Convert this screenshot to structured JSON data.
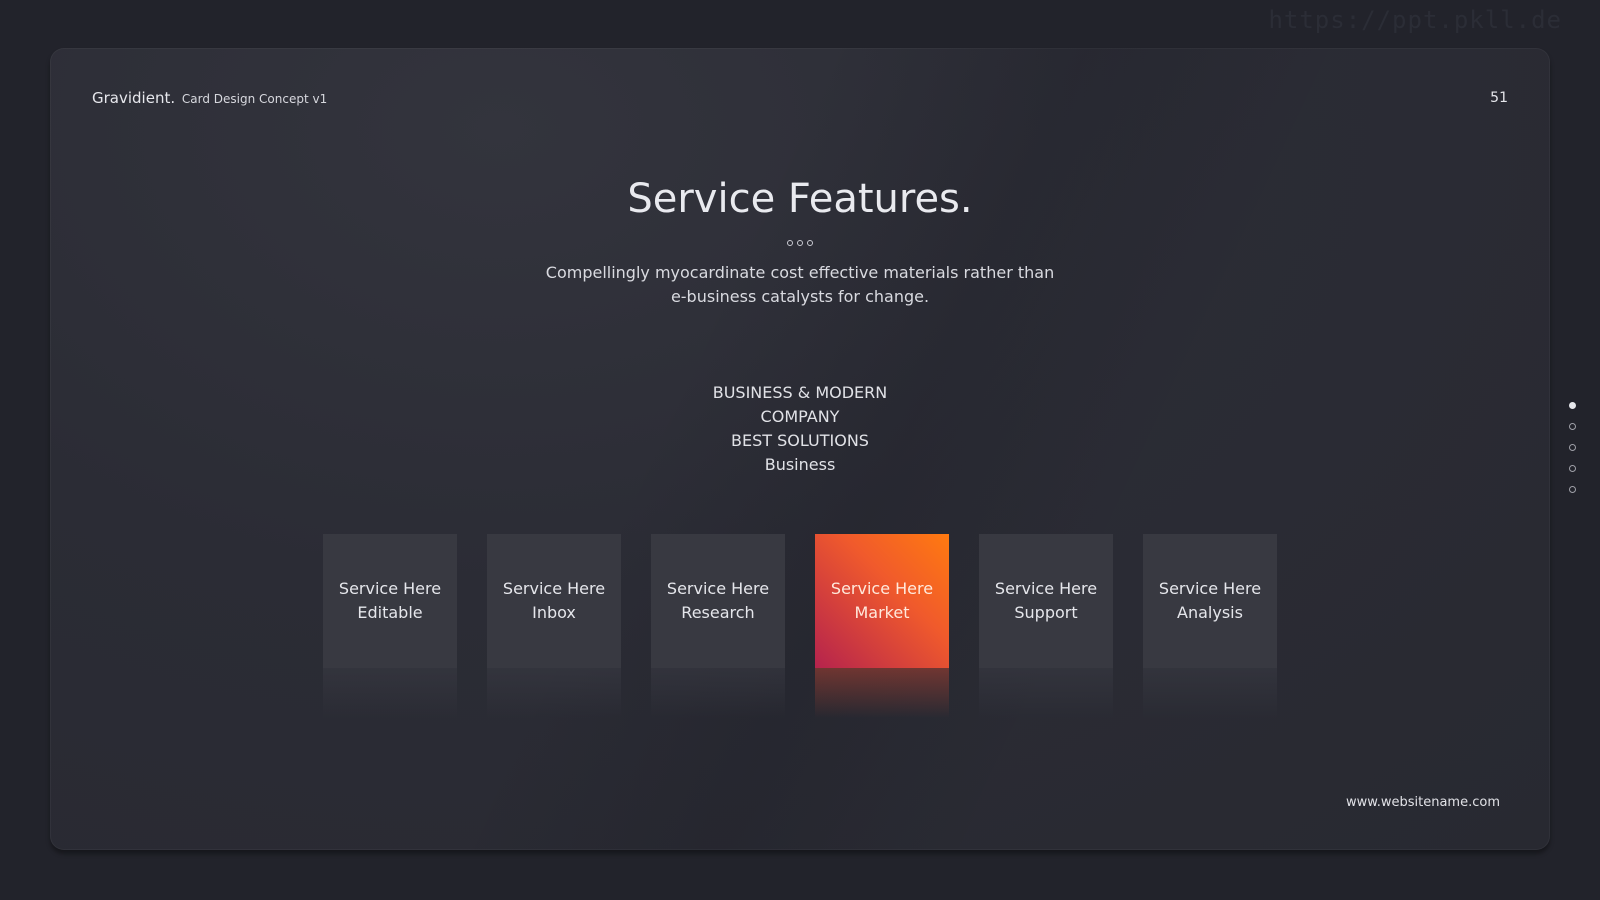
{
  "watermark": "https://ppt.pkll.de",
  "header": {
    "brand": "Gravidient.",
    "brand_sub": "Card Design Concept v1",
    "page_number": "51"
  },
  "main": {
    "title": "Service Features.",
    "subtitle_line1": "Compellingly myocardinate cost effective materials rather than",
    "subtitle_line2": "e-business catalysts for change.",
    "tagline": [
      "BUSINESS & MODERN",
      "COMPANY",
      "BEST SOLUTIONS",
      "Business"
    ]
  },
  "cards": [
    {
      "line1": "Service Here",
      "line2": "Editable",
      "active": false
    },
    {
      "line1": "Service Here",
      "line2": "Inbox",
      "active": false
    },
    {
      "line1": "Service Here",
      "line2": "Research",
      "active": false
    },
    {
      "line1": "Service Here",
      "line2": "Market",
      "active": true
    },
    {
      "line1": "Service Here",
      "line2": "Support",
      "active": false
    },
    {
      "line1": "Service Here",
      "line2": "Analysis",
      "active": false
    }
  ],
  "footer": {
    "url": "www.websitename.com"
  },
  "side_nav": {
    "total": 5,
    "current": 1
  },
  "colors": {
    "active_card_start": "#ff7a10",
    "active_card_end": "#b5234d",
    "card_bg": "#383941",
    "page_bg": "#22232b"
  }
}
